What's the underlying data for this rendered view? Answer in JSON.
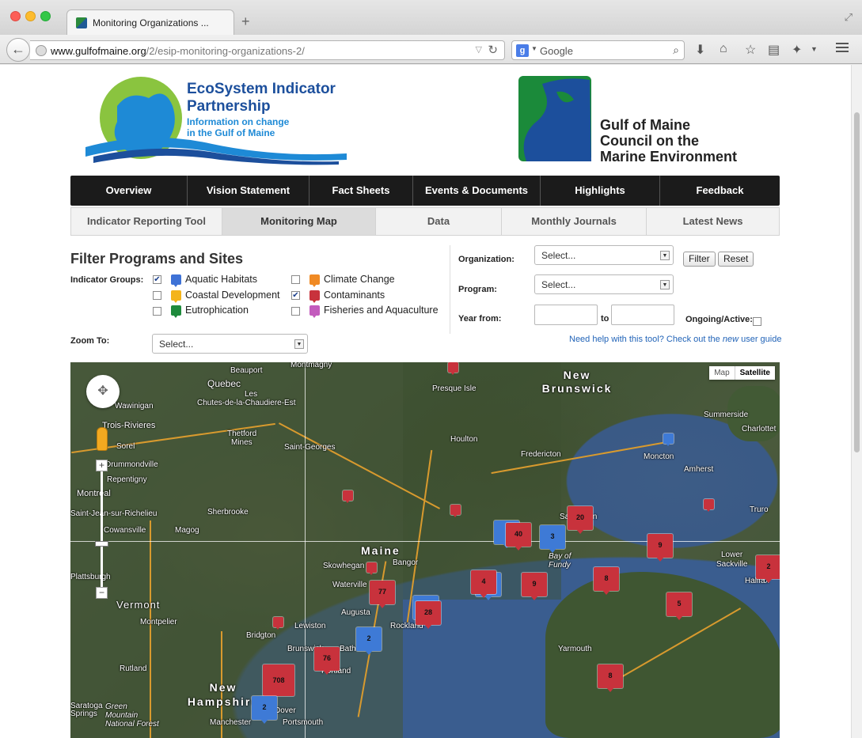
{
  "browser": {
    "tab_title": "Monitoring Organizations ...",
    "new_tab": "+",
    "url_domain": "www.gulfofmaine.org",
    "url_path": "/2/esip-monitoring-organizations-2/",
    "search_placeholder": "Google",
    "search_engine_icon": "g"
  },
  "header": {
    "esip_line1": "EcoSystem Indicator",
    "esip_line2": "Partnership",
    "esip_tagline1": "Information on change",
    "esip_tagline2": "in the Gulf of Maine",
    "gom_line1": "Gulf of Maine",
    "gom_line2": "Council on the",
    "gom_line3": "Marine Environment"
  },
  "main_nav": [
    "Overview",
    "Vision Statement",
    "Fact Sheets",
    "Events & Documents",
    "Highlights",
    "Feedback"
  ],
  "sub_nav": {
    "items": [
      "Indicator Reporting Tool",
      "Monitoring Map",
      "Data",
      "Monthly Journals",
      "Latest News"
    ],
    "active": "Monitoring Map"
  },
  "filter": {
    "title": "Filter Programs and Sites",
    "indicator_groups_label": "Indicator Groups:",
    "groups": [
      {
        "name": "Aquatic Habitats",
        "checked": true,
        "color": "#3e72d6"
      },
      {
        "name": "Coastal Development",
        "checked": false,
        "color": "#f4b41a"
      },
      {
        "name": "Eutrophication",
        "checked": false,
        "color": "#1e8a3c"
      },
      {
        "name": "Climate Change",
        "checked": false,
        "color": "#f08a24"
      },
      {
        "name": "Contaminants",
        "checked": true,
        "color": "#c8323c"
      },
      {
        "name": "Fisheries and Aquaculture",
        "checked": false,
        "color": "#c35bbd"
      }
    ],
    "check_glyph": "✔",
    "zoom_label": "Zoom To:",
    "zoom_value": "Select...",
    "organization_label": "Organization:",
    "organization_value": "Select...",
    "program_label": "Program:",
    "program_value": "Select...",
    "year_from_label": "Year from:",
    "year_to_label": "to",
    "ongoing_label": "Ongoing/Active:",
    "filter_button": "Filter",
    "reset_button": "Reset",
    "help_prefix": "Need help with this tool? Check out the ",
    "help_emphasis": "new",
    "help_suffix": " user guide"
  },
  "map": {
    "type_map": "Map",
    "type_satellite": "Satellite",
    "zoom_in": "+",
    "zoom_out": "−",
    "places": [
      "Beauport",
      "Montmagny",
      "Quebec",
      "Les",
      "Chutes-de-la-Chaudiere-Est",
      "Wawinigan",
      "Trois-Rivieres",
      "Sorel",
      "Drummondville",
      "Repentigny",
      "Montreal",
      "Saint-Jean-sur-Richelieu",
      "Sherbrooke",
      "Cowansville",
      "Magog",
      "Thetford",
      "Mines",
      "Saint-Georges",
      "Presque Isle",
      "Houlton",
      "Fredericton",
      "Moncton",
      "Summerside",
      "Charlottet",
      "Amherst",
      "Truro",
      "Saint John",
      "Lower",
      "Sackville",
      "Halifax",
      "Yarmouth",
      "Bangor",
      "Skowhegan",
      "Waterville",
      "Augusta",
      "Rockland",
      "Lewiston",
      "Bridgton",
      "Brunswick",
      "Bath",
      "Portland",
      "Montpelier",
      "Rutland",
      "Manchester",
      "Portsmouth",
      "Dover",
      "Saratoga Springs",
      "Green Mountain National Forest",
      "Bay of Fundy",
      "Plattsburgh"
    ],
    "regions": [
      "New Brunswick",
      "Maine",
      "Vermont",
      "New Hampshire"
    ],
    "clusters": [
      {
        "count": "40",
        "color": "red"
      },
      {
        "count": "3",
        "color": "blue"
      },
      {
        "count": "20",
        "color": "red"
      },
      {
        "count": "9",
        "color": "red"
      },
      {
        "count": "77",
        "color": "red"
      },
      {
        "count": "4",
        "color": "red"
      },
      {
        "count": "9",
        "color": "red"
      },
      {
        "count": "28",
        "color": "red"
      },
      {
        "count": "8",
        "color": "red"
      },
      {
        "count": "5",
        "color": "red"
      },
      {
        "count": "2",
        "color": "red"
      },
      {
        "count": "2",
        "color": "blue"
      },
      {
        "count": "76",
        "color": "red"
      },
      {
        "count": "708",
        "color": "red"
      },
      {
        "count": "2",
        "color": "blue"
      },
      {
        "count": "8",
        "color": "red"
      }
    ]
  }
}
